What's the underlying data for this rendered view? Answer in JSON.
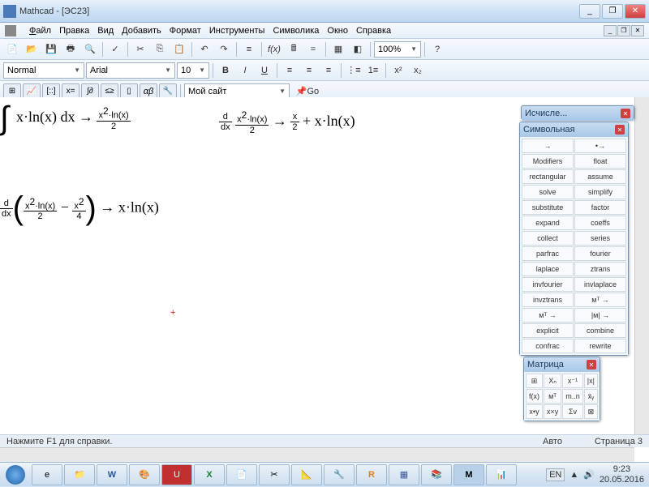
{
  "window": {
    "title": "Mathcad - [ЭС23]",
    "min": "_",
    "max": "❐",
    "close": "✕"
  },
  "mdi": {
    "min": "_",
    "max": "❐",
    "close": "✕"
  },
  "menu": {
    "file": "Файл",
    "edit": "Правка",
    "view": "Вид",
    "insert": "Добавить",
    "format": "Формат",
    "tools": "Инструменты",
    "symbolics": "Символика",
    "window": "Окно",
    "help": "Справка"
  },
  "format_bar": {
    "style": "Normal",
    "font": "Arial",
    "size": "10"
  },
  "zoom": "100%",
  "site_combo": "Мой сайт",
  "go": "Go",
  "palettes": {
    "calc_tab": "Исчисле...",
    "symbolic": {
      "title": "Символьная",
      "rows": [
        [
          "→",
          "•→"
        ],
        [
          "Modifiers",
          "float"
        ],
        [
          "rectangular",
          "assume"
        ],
        [
          "solve",
          "simplify"
        ],
        [
          "substitute",
          "factor"
        ],
        [
          "expand",
          "coeffs"
        ],
        [
          "collect",
          "series"
        ],
        [
          "parfrac",
          "fourier"
        ],
        [
          "laplace",
          "ztrans"
        ],
        [
          "invfourier",
          "invlaplace"
        ],
        [
          "invztrans",
          "мᵀ →"
        ],
        [
          "мᵀ →",
          "|м| →"
        ],
        [
          "explicit",
          "combine"
        ],
        [
          "confrac",
          "rewrite"
        ]
      ]
    },
    "matrix": {
      "title": "Матрица",
      "rows": [
        [
          "⊞",
          "Xₙ",
          "x⁻¹",
          "|x|"
        ],
        [
          "f(x)",
          "мᵀ",
          "m..n",
          "x̄ᵧ"
        ],
        [
          "x•y",
          "x×y",
          "Σv",
          "⊠"
        ]
      ]
    }
  },
  "status": {
    "help": "Нажмите F1 для справки.",
    "auto": "Авто",
    "page": "Страница 3"
  },
  "tray": {
    "lang": "EN",
    "time": "9:23",
    "date": "20.05.2016"
  }
}
